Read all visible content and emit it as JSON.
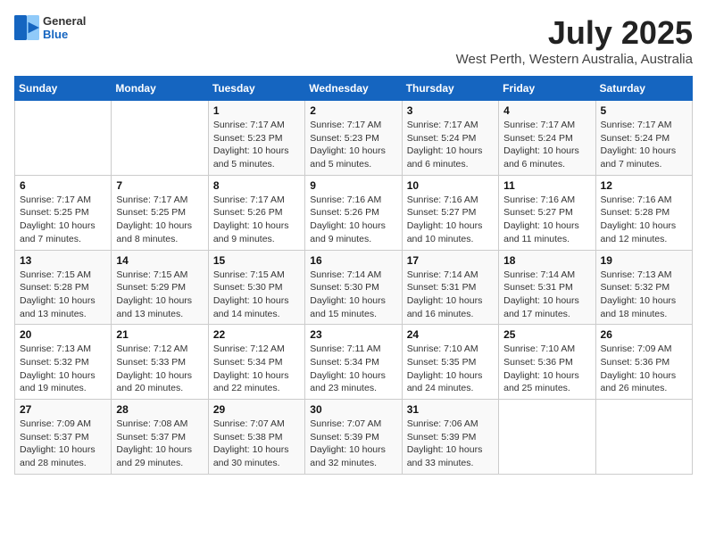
{
  "header": {
    "logo_general": "General",
    "logo_blue": "Blue",
    "title": "July 2025",
    "subtitle": "West Perth, Western Australia, Australia"
  },
  "calendar": {
    "weekdays": [
      "Sunday",
      "Monday",
      "Tuesday",
      "Wednesday",
      "Thursday",
      "Friday",
      "Saturday"
    ],
    "weeks": [
      [
        {
          "day": "",
          "info": ""
        },
        {
          "day": "",
          "info": ""
        },
        {
          "day": "1",
          "info": "Sunrise: 7:17 AM\nSunset: 5:23 PM\nDaylight: 10 hours and 5 minutes."
        },
        {
          "day": "2",
          "info": "Sunrise: 7:17 AM\nSunset: 5:23 PM\nDaylight: 10 hours and 5 minutes."
        },
        {
          "day": "3",
          "info": "Sunrise: 7:17 AM\nSunset: 5:24 PM\nDaylight: 10 hours and 6 minutes."
        },
        {
          "day": "4",
          "info": "Sunrise: 7:17 AM\nSunset: 5:24 PM\nDaylight: 10 hours and 6 minutes."
        },
        {
          "day": "5",
          "info": "Sunrise: 7:17 AM\nSunset: 5:24 PM\nDaylight: 10 hours and 7 minutes."
        }
      ],
      [
        {
          "day": "6",
          "info": "Sunrise: 7:17 AM\nSunset: 5:25 PM\nDaylight: 10 hours and 7 minutes."
        },
        {
          "day": "7",
          "info": "Sunrise: 7:17 AM\nSunset: 5:25 PM\nDaylight: 10 hours and 8 minutes."
        },
        {
          "day": "8",
          "info": "Sunrise: 7:17 AM\nSunset: 5:26 PM\nDaylight: 10 hours and 9 minutes."
        },
        {
          "day": "9",
          "info": "Sunrise: 7:16 AM\nSunset: 5:26 PM\nDaylight: 10 hours and 9 minutes."
        },
        {
          "day": "10",
          "info": "Sunrise: 7:16 AM\nSunset: 5:27 PM\nDaylight: 10 hours and 10 minutes."
        },
        {
          "day": "11",
          "info": "Sunrise: 7:16 AM\nSunset: 5:27 PM\nDaylight: 10 hours and 11 minutes."
        },
        {
          "day": "12",
          "info": "Sunrise: 7:16 AM\nSunset: 5:28 PM\nDaylight: 10 hours and 12 minutes."
        }
      ],
      [
        {
          "day": "13",
          "info": "Sunrise: 7:15 AM\nSunset: 5:28 PM\nDaylight: 10 hours and 13 minutes."
        },
        {
          "day": "14",
          "info": "Sunrise: 7:15 AM\nSunset: 5:29 PM\nDaylight: 10 hours and 13 minutes."
        },
        {
          "day": "15",
          "info": "Sunrise: 7:15 AM\nSunset: 5:30 PM\nDaylight: 10 hours and 14 minutes."
        },
        {
          "day": "16",
          "info": "Sunrise: 7:14 AM\nSunset: 5:30 PM\nDaylight: 10 hours and 15 minutes."
        },
        {
          "day": "17",
          "info": "Sunrise: 7:14 AM\nSunset: 5:31 PM\nDaylight: 10 hours and 16 minutes."
        },
        {
          "day": "18",
          "info": "Sunrise: 7:14 AM\nSunset: 5:31 PM\nDaylight: 10 hours and 17 minutes."
        },
        {
          "day": "19",
          "info": "Sunrise: 7:13 AM\nSunset: 5:32 PM\nDaylight: 10 hours and 18 minutes."
        }
      ],
      [
        {
          "day": "20",
          "info": "Sunrise: 7:13 AM\nSunset: 5:32 PM\nDaylight: 10 hours and 19 minutes."
        },
        {
          "day": "21",
          "info": "Sunrise: 7:12 AM\nSunset: 5:33 PM\nDaylight: 10 hours and 20 minutes."
        },
        {
          "day": "22",
          "info": "Sunrise: 7:12 AM\nSunset: 5:34 PM\nDaylight: 10 hours and 22 minutes."
        },
        {
          "day": "23",
          "info": "Sunrise: 7:11 AM\nSunset: 5:34 PM\nDaylight: 10 hours and 23 minutes."
        },
        {
          "day": "24",
          "info": "Sunrise: 7:10 AM\nSunset: 5:35 PM\nDaylight: 10 hours and 24 minutes."
        },
        {
          "day": "25",
          "info": "Sunrise: 7:10 AM\nSunset: 5:36 PM\nDaylight: 10 hours and 25 minutes."
        },
        {
          "day": "26",
          "info": "Sunrise: 7:09 AM\nSunset: 5:36 PM\nDaylight: 10 hours and 26 minutes."
        }
      ],
      [
        {
          "day": "27",
          "info": "Sunrise: 7:09 AM\nSunset: 5:37 PM\nDaylight: 10 hours and 28 minutes."
        },
        {
          "day": "28",
          "info": "Sunrise: 7:08 AM\nSunset: 5:37 PM\nDaylight: 10 hours and 29 minutes."
        },
        {
          "day": "29",
          "info": "Sunrise: 7:07 AM\nSunset: 5:38 PM\nDaylight: 10 hours and 30 minutes."
        },
        {
          "day": "30",
          "info": "Sunrise: 7:07 AM\nSunset: 5:39 PM\nDaylight: 10 hours and 32 minutes."
        },
        {
          "day": "31",
          "info": "Sunrise: 7:06 AM\nSunset: 5:39 PM\nDaylight: 10 hours and 33 minutes."
        },
        {
          "day": "",
          "info": ""
        },
        {
          "day": "",
          "info": ""
        }
      ]
    ]
  }
}
